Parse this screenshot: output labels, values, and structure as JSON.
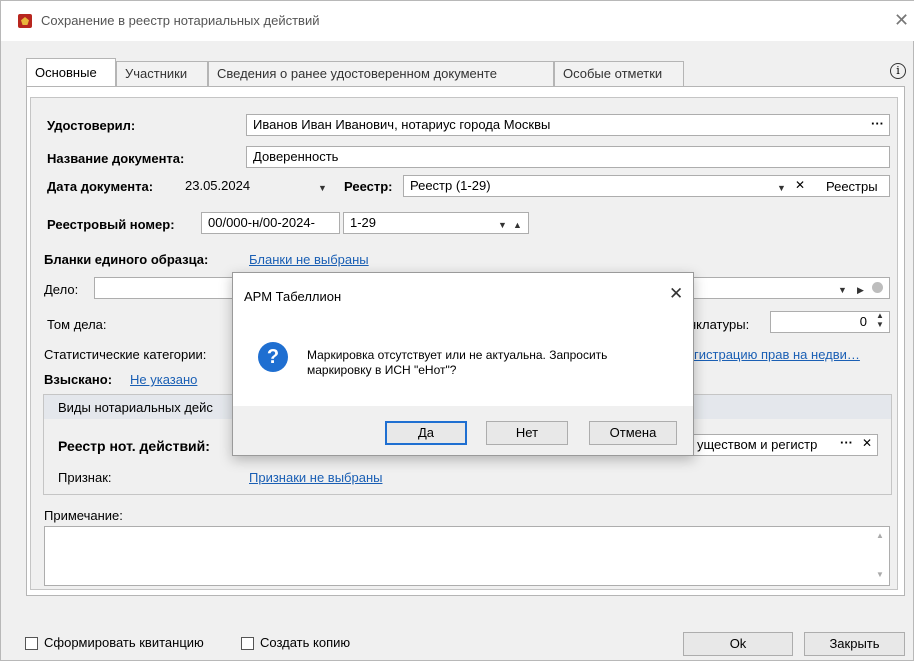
{
  "window": {
    "title": "Сохранение в реестр нотариальных действий",
    "close_glyph": "✕"
  },
  "tabs": [
    {
      "label": "Основные"
    },
    {
      "label": "Участники"
    },
    {
      "label": "Сведения о ранее удостоверенном документе"
    },
    {
      "label": "Особые отметки"
    }
  ],
  "info_glyph": "i",
  "form": {
    "certified_label": "Удостоверил:",
    "certified_value": "Иванов Иван Иванович, нотариус города Москвы",
    "ellipsis": "···",
    "docname_label": "Название документа:",
    "docname_value": "Доверенность",
    "docdate_label": "Дата документа:",
    "docdate_value": "23.05.2024",
    "registry_label": "Реестр:",
    "registry_value": "Реестр (1-29)",
    "registries_button": "Реестры",
    "regnum_label": "Реестровый номер:",
    "regnum_prefix": "00/000-н/00-2024-",
    "regnum_value": "1-29",
    "blanks_label": "Бланки единого образца:",
    "blanks_link": "Бланки не выбраны",
    "case_label": "Дело:",
    "volume_label": "Том дела:",
    "nomenclature_label": "нклатуры:",
    "nomenclature_value": "0",
    "stat_label": "Статистические категории:",
    "stat_link": "гистрацию прав на недви…",
    "charged_label": "Взыскано:",
    "charged_link": "Не указано",
    "group_header": "Виды нотариальных дейс",
    "registry_actions_label": "Реестр нот. действий:",
    "registry_actions_value": "уществом и регистр",
    "sign_label": "Признак:",
    "sign_link": "Признаки не выбраны",
    "note_label": "Примечание:",
    "note_value": ""
  },
  "bottom": {
    "receipt_label": "Сформировать квитанцию",
    "copy_label": "Создать копию",
    "ok_label": "Ok",
    "close_label": "Закрыть"
  },
  "dialog": {
    "title": "АРМ Табеллион",
    "close_glyph": "✕",
    "icon_glyph": "?",
    "message_line1": "Маркировка отсутствует или не актуальна. Запросить",
    "message_line2": "маркировку в ИСН \"еНот\"?",
    "yes_label": "Да",
    "no_label": "Нет",
    "cancel_label": "Отмена"
  }
}
